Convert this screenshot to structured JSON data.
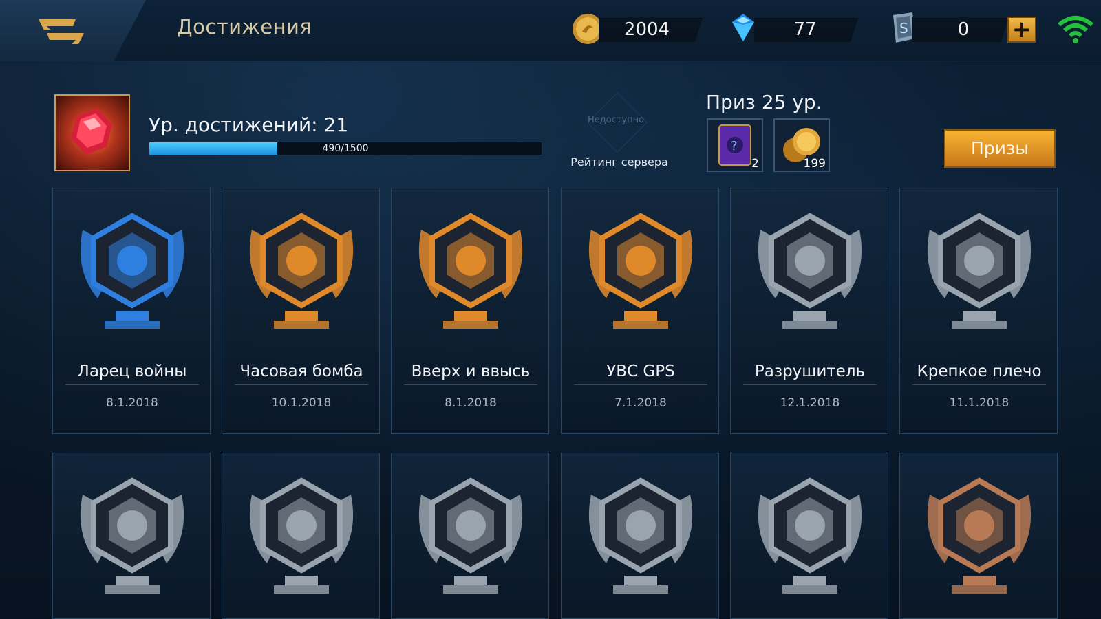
{
  "header": {
    "title": "Достижения",
    "coins": "2004",
    "diamonds": "77",
    "tickets": "0",
    "plus_label": "+"
  },
  "level": {
    "label": "Ур. достижений: 21",
    "progress_text": "490/1500",
    "progress_fraction": 0.3267
  },
  "rank": {
    "status": "Недоступно",
    "label": "Рейтинг сервера"
  },
  "reward": {
    "title": "Приз 25 ур.",
    "items": [
      {
        "icon": "mystery-card-icon",
        "count": "2"
      },
      {
        "icon": "gold-coins-icon",
        "count": "199"
      }
    ],
    "button_label": "Призы"
  },
  "achievements": [
    {
      "name": "Ларец войны",
      "date": "8.1.2018",
      "icon": "treasure-chest-badge",
      "color": "#2f7fe0"
    },
    {
      "name": "Часовая бомба",
      "date": "10.1.2018",
      "icon": "hourglass-badge",
      "color": "#e0892b"
    },
    {
      "name": "Вверх и ввысь",
      "date": "8.1.2018",
      "icon": "book-badge",
      "color": "#e0892b"
    },
    {
      "name": "УВС GPS",
      "date": "7.1.2018",
      "icon": "crossed-swords-badge",
      "color": "#e0892b"
    },
    {
      "name": "Разрушитель",
      "date": "12.1.2018",
      "icon": "skull-badge",
      "color": "#9aa4ae"
    },
    {
      "name": "Крепкое плечо",
      "date": "11.1.2018",
      "icon": "arm-badge",
      "color": "#9aa4ae"
    },
    {
      "name": "",
      "date": "",
      "icon": "flag-badge",
      "color": "#9aa4ae"
    },
    {
      "name": "",
      "date": "",
      "icon": "rabbit-badge",
      "color": "#9aa4ae"
    },
    {
      "name": "",
      "date": "",
      "icon": "golden-hero-badge",
      "color": "#9aa4ae"
    },
    {
      "name": "",
      "date": "",
      "icon": "meditation-badge",
      "color": "#9aa4ae"
    },
    {
      "name": "",
      "date": "",
      "icon": "shield-badge",
      "color": "#9aa4ae"
    },
    {
      "name": "",
      "date": "",
      "icon": "bronze-swords-badge",
      "color": "#b87a55"
    }
  ]
}
